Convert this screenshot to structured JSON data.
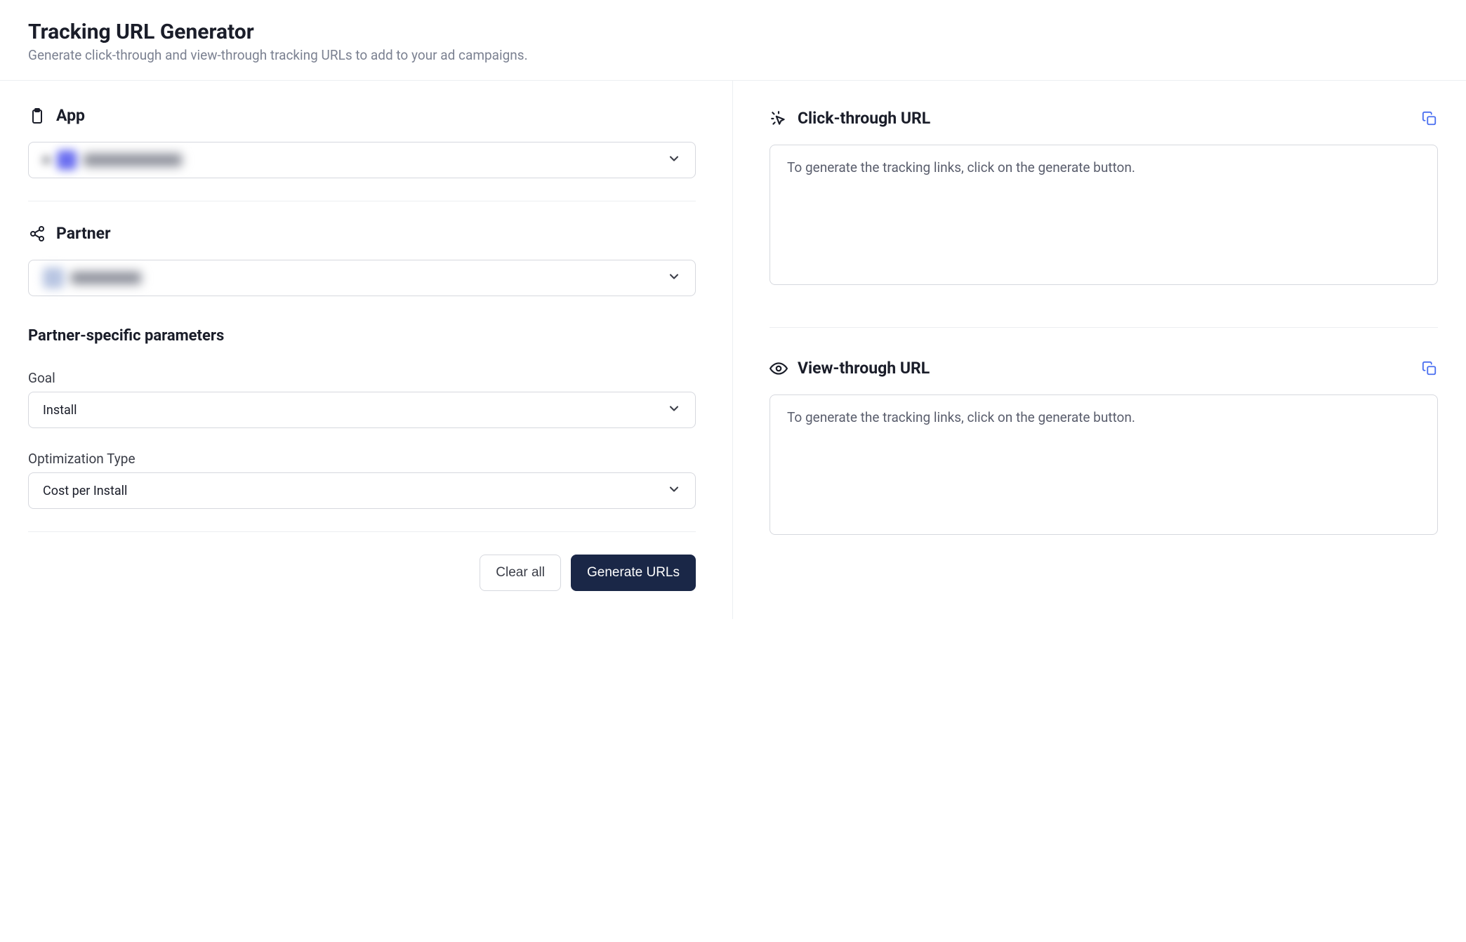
{
  "header": {
    "title": "Tracking URL Generator",
    "subtitle": "Generate click-through and view-through tracking URLs to add to your ad campaigns."
  },
  "left": {
    "app": {
      "label": "App",
      "selected": ""
    },
    "partner": {
      "label": "Partner",
      "selected": ""
    },
    "params": {
      "title": "Partner-specific parameters",
      "goal": {
        "label": "Goal",
        "value": "Install"
      },
      "optimization": {
        "label": "Optimization Type",
        "value": "Cost per Install"
      }
    },
    "buttons": {
      "clear": "Clear all",
      "generate": "Generate URLs"
    }
  },
  "right": {
    "click": {
      "title": "Click-through URL",
      "placeholder": "To generate the tracking links, click on the generate button."
    },
    "view": {
      "title": "View-through URL",
      "placeholder": "To generate the tracking links, click on the generate button."
    }
  }
}
